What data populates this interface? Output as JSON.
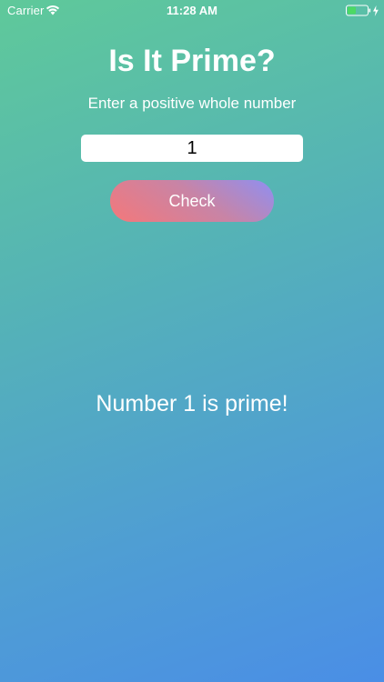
{
  "status_bar": {
    "carrier": "Carrier",
    "time": "11:28 AM",
    "wifi_icon": "wifi-icon",
    "battery_icon": "battery-charging-icon",
    "battery_color": "#4cd964"
  },
  "main": {
    "title": "Is It Prime?",
    "subtitle": "Enter a positive whole number",
    "input_value": "1",
    "check_label": "Check",
    "result_text": "Number 1 is prime!"
  },
  "colors": {
    "background_start": "#5fc99a",
    "background_end": "#4a8ee6",
    "button_start": "#f4787a",
    "button_end": "#8f8ff2"
  }
}
